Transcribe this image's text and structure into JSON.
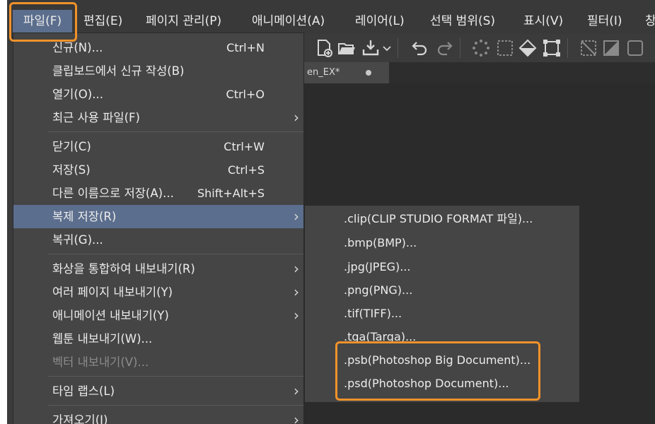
{
  "menubar": {
    "items": [
      {
        "label": "파일(F)"
      },
      {
        "label": "편집(E)"
      },
      {
        "label": "페이지 관리(P)"
      },
      {
        "label": "애니메이션(A)"
      },
      {
        "label": "레이어(L)"
      },
      {
        "label": "선택 범위(S)"
      },
      {
        "label": "표시(V)"
      },
      {
        "label": "필터(I)"
      },
      {
        "label": "창"
      }
    ]
  },
  "tab": {
    "title": "en_EX*"
  },
  "file_menu": {
    "items": [
      {
        "label": "신규(N)...",
        "shortcut": "Ctrl+N"
      },
      {
        "label": "클립보드에서 신규 작성(B)",
        "shortcut": ""
      },
      {
        "label": "열기(O)...",
        "shortcut": "Ctrl+O"
      },
      {
        "label": "최근 사용 파일(F)",
        "shortcut": "",
        "arrow": "›"
      },
      {
        "label": "닫기(C)",
        "shortcut": "Ctrl+W"
      },
      {
        "label": "저장(S)",
        "shortcut": "Ctrl+S"
      },
      {
        "label": "다른 이름으로 저장(A)...",
        "shortcut": "Shift+Alt+S"
      },
      {
        "label": "복제 저장(R)",
        "shortcut": "",
        "arrow": "›"
      },
      {
        "label": "복귀(G)...",
        "shortcut": ""
      },
      {
        "label": "화상을 통합하여 내보내기(R)",
        "shortcut": "",
        "arrow": "›"
      },
      {
        "label": "여러 페이지 내보내기(Y)",
        "shortcut": "",
        "arrow": "›"
      },
      {
        "label": "애니메이션 내보내기(Y)",
        "shortcut": "",
        "arrow": "›"
      },
      {
        "label": "웹툰 내보내기(W)...",
        "shortcut": ""
      },
      {
        "label": "벡터 내보내기(V)...",
        "shortcut": ""
      },
      {
        "label": "타임 랩스(L)",
        "shortcut": "",
        "arrow": "›"
      },
      {
        "label": "가져오기(I)",
        "shortcut": "",
        "arrow": "›"
      }
    ]
  },
  "submenu": {
    "items": [
      {
        "label": ".clip(CLIP STUDIO FORMAT 파일)..."
      },
      {
        "label": ".bmp(BMP)..."
      },
      {
        "label": ".jpg(JPEG)..."
      },
      {
        "label": ".png(PNG)..."
      },
      {
        "label": ".tif(TIFF)..."
      },
      {
        "label": ".tga(Targa)..."
      },
      {
        "label": ".psb(Photoshop Big Document)..."
      },
      {
        "label": ".psd(Photoshop Document)..."
      }
    ]
  },
  "toolbar": {
    "icons": [
      "new-canvas-icon",
      "open-folder-icon",
      "save-icon",
      "dropdown-chevron-icon",
      "undo-icon",
      "redo-icon",
      "loading-icon",
      "selection-icon",
      "fill-icon",
      "transform-icon",
      "ruler-disabled-icon",
      "grid-icon",
      "frame-icon"
    ]
  },
  "colors": {
    "accent_highlight": "#f0922a",
    "selection": "#5c6e8d",
    "menu_bg": "#454545"
  }
}
